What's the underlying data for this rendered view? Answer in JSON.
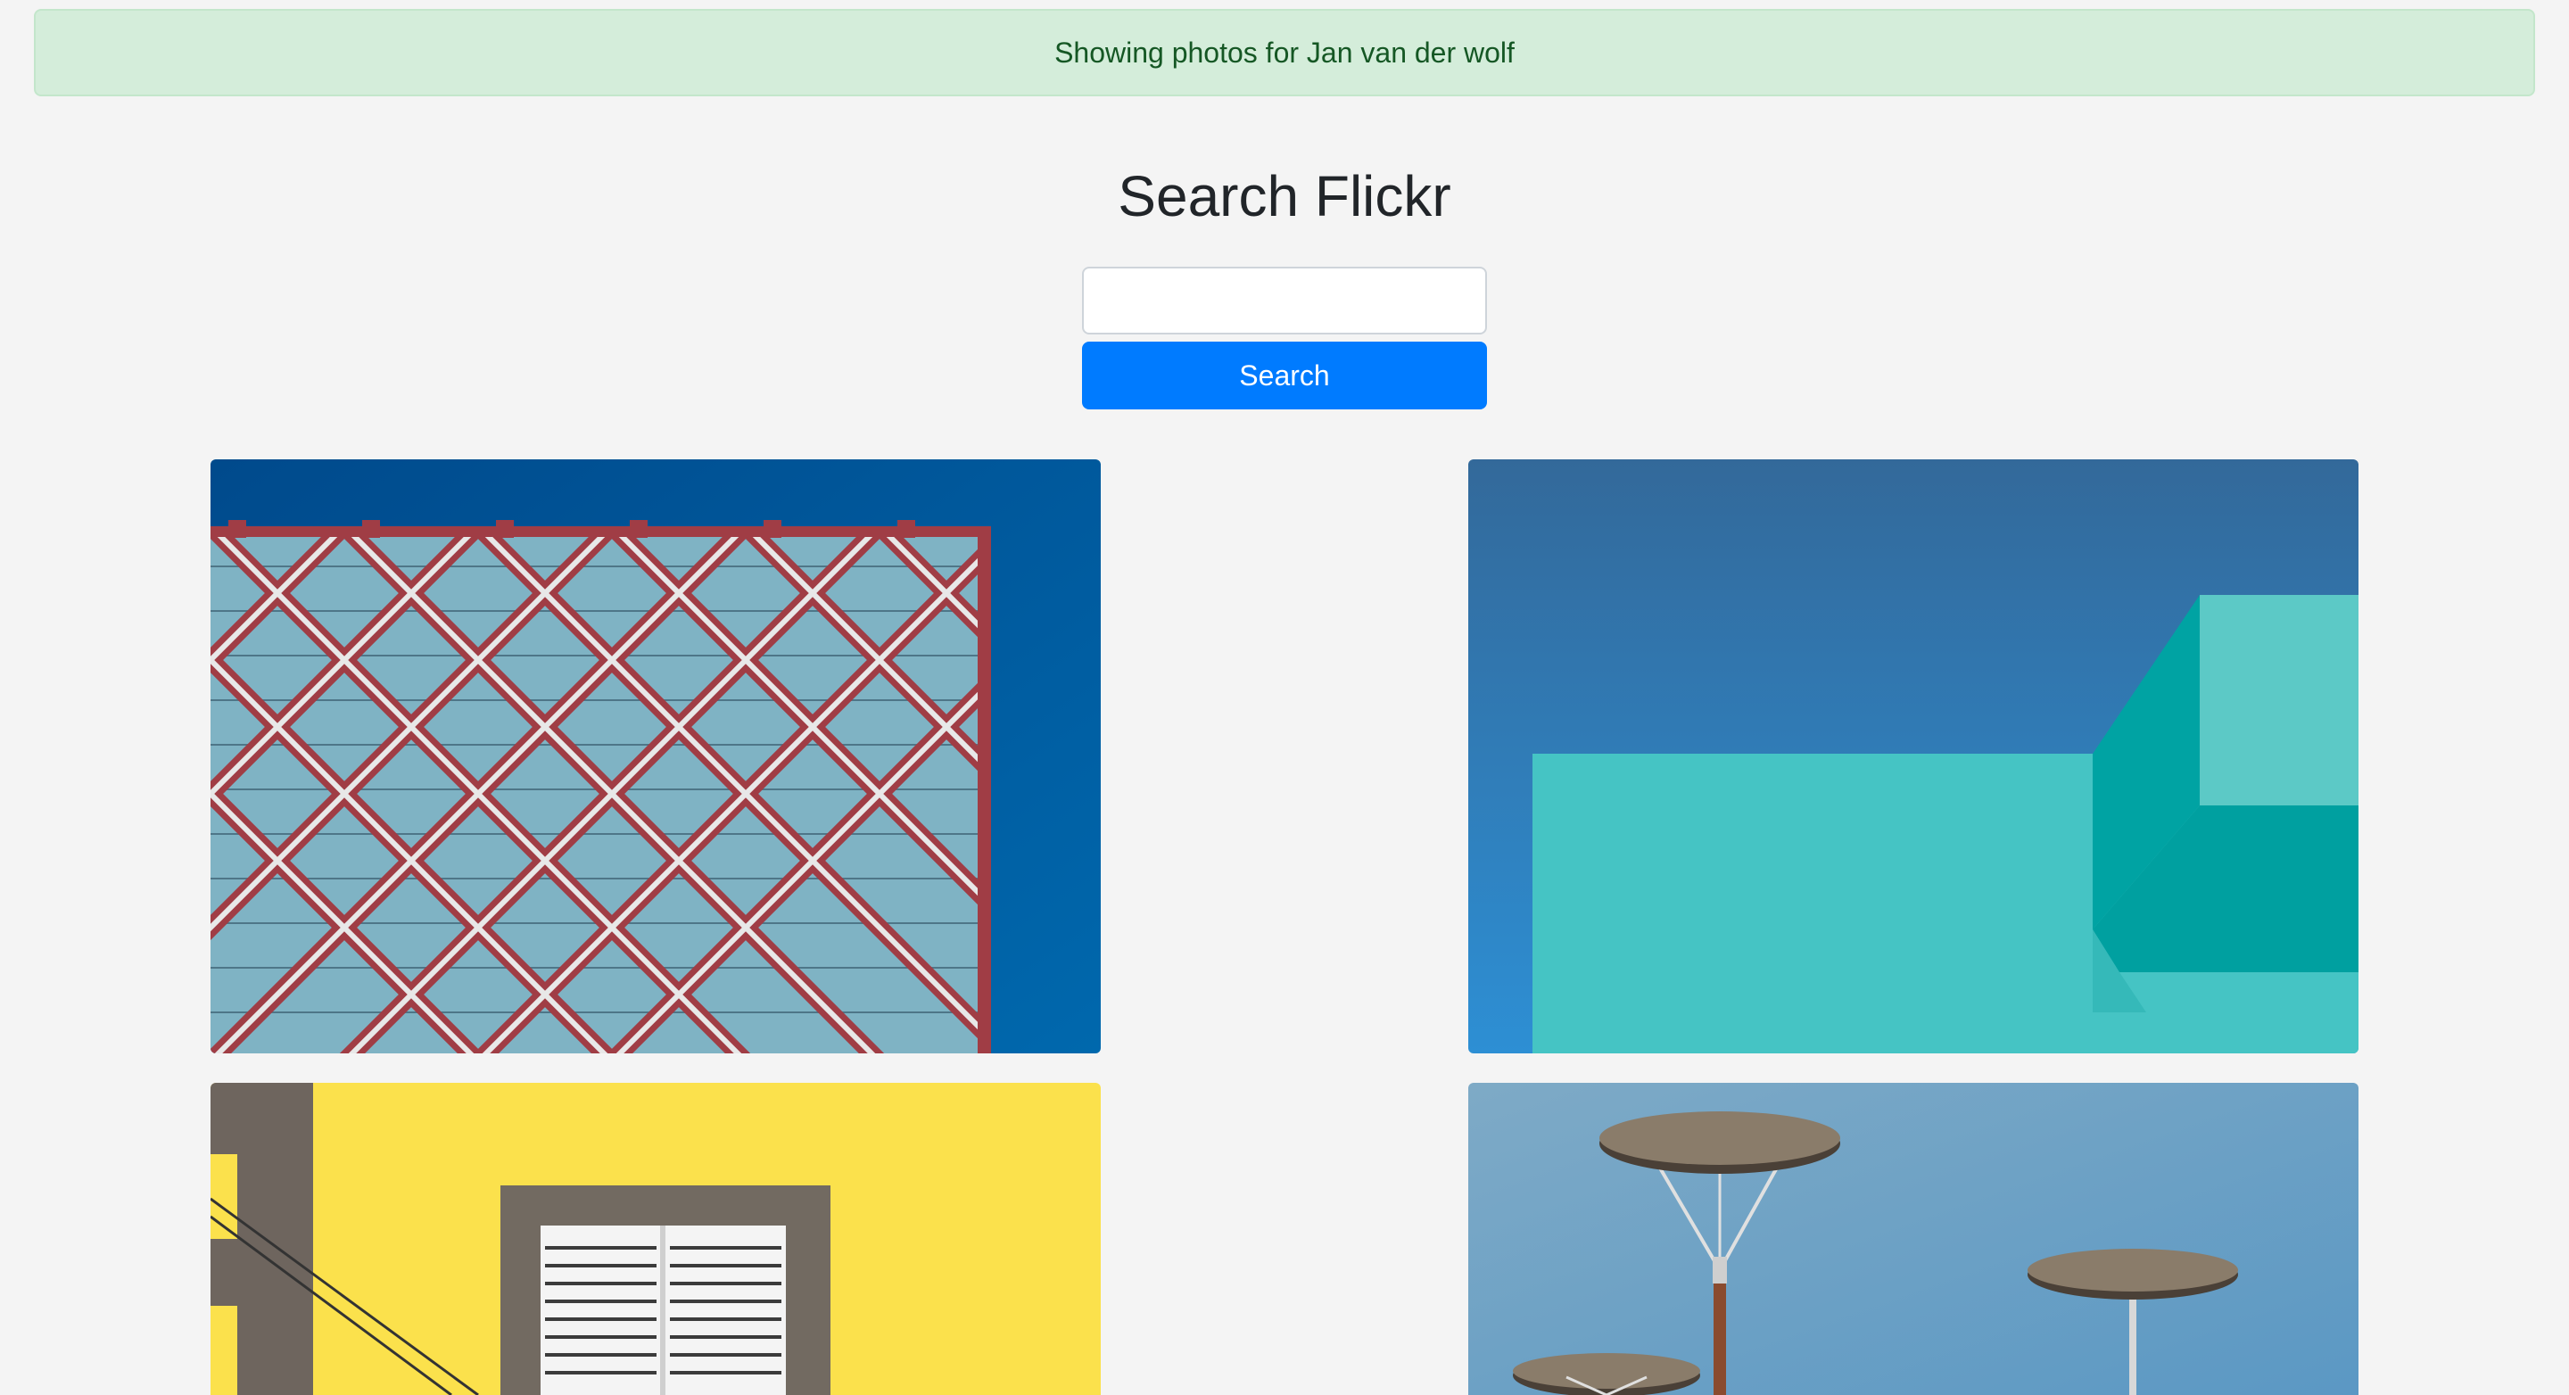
{
  "alert": {
    "message": "Showing photos for Jan van der wolf"
  },
  "header": {
    "title": "Search Flickr"
  },
  "search": {
    "value": "",
    "placeholder": "",
    "button_label": "Search"
  },
  "photos": [
    {
      "subject": "red lattice facade building against blue sky"
    },
    {
      "subject": "turquoise wall against blue sky"
    },
    {
      "subject": "yellow wall with shuttered window"
    },
    {
      "subject": "disc-shaped street lamps against sky"
    }
  ],
  "colors": {
    "alert_bg": "#d4edda",
    "alert_text": "#155724",
    "primary": "#007bff",
    "page_bg": "#f4f4f4"
  }
}
